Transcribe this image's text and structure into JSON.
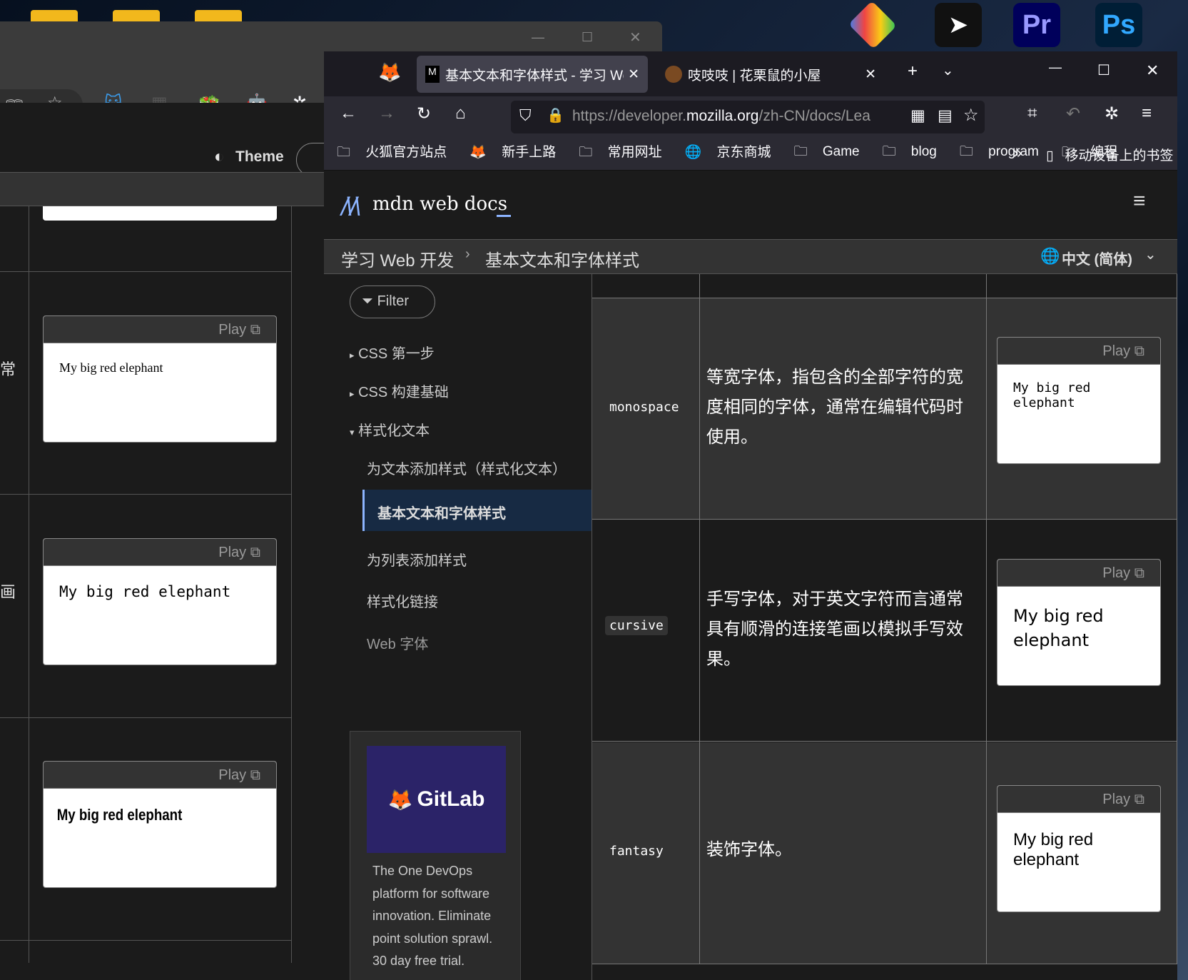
{
  "desktop": {
    "icons": [
      "folder-icon",
      "folder-icon",
      "folder-icon",
      "git-app-icon",
      "navigation-app-icon",
      "premiere-pro-icon",
      "photoshop-icon"
    ],
    "pr_label": "Pr",
    "ps_label": "Ps"
  },
  "back_window": {
    "theme_label": "Theme",
    "cards": [
      {
        "play": "Play",
        "text": "My big red elephant"
      },
      {
        "play": "Play",
        "text": "My big red elephant"
      },
      {
        "play": "Play",
        "text": "My big red elephant"
      }
    ],
    "side_chars": [
      "常",
      "画"
    ]
  },
  "browser": {
    "tabs": [
      {
        "title": "基本文本和字体样式 - 学习 Web",
        "active": true
      },
      {
        "title": "吱吱吱 | 花栗鼠的小屋",
        "active": false
      }
    ],
    "url": "https://developer.mozilla.org/zh-CN/docs/Learn",
    "url_prefix": "https://developer.",
    "url_domain": "mozilla.org",
    "url_rest": "/zh-CN/docs/Lea",
    "bookmarks": [
      "火狐官方站点",
      "新手上路",
      "常用网址",
      "京东商城",
      "Game",
      "blog",
      "program",
      "编程"
    ],
    "mobile_bookmarks": "移动设备上的书签"
  },
  "mdn": {
    "logo": "mdn web docs",
    "breadcrumb": [
      "学习 Web 开发",
      "基本文本和字体样式"
    ],
    "language": "中文 (简体)",
    "filter": "Filter",
    "sidebar": [
      {
        "label": "CSS 第一步",
        "marker": "▸"
      },
      {
        "label": "CSS 构建基础",
        "marker": "▸"
      },
      {
        "label": "样式化文本",
        "marker": "▾"
      }
    ],
    "sub_items": [
      "为文本添加样式（样式化文本）",
      "基本文本和字体样式",
      "为列表添加样式",
      "样式化链接",
      "Web 字体"
    ],
    "active_item": "基本文本和字体样式",
    "ad": {
      "brand": "GitLab",
      "text": "The One DevOps platform for software innovation. Eliminate point solution sprawl. 30 day free trial."
    },
    "rows": [
      {
        "name": "monospace",
        "desc": "等宽字体，指包含的全部字符的宽度相同的字体，通常在编辑代码时使用。",
        "play": "Play",
        "sample": "My big red elephant"
      },
      {
        "name": "cursive",
        "desc": "手写字体，对于英文字符而言通常具有顺滑的连接笔画以模拟手写效果。",
        "play": "Play",
        "sample": "My big red elephant"
      },
      {
        "name": "fantasy",
        "desc": "装饰字体。",
        "play": "Play",
        "sample": "My big red elephant"
      }
    ]
  },
  "colors": {
    "accent": "#8cb4ff",
    "active_bg": "#172a43",
    "gitlab_bg": "#2b2368",
    "gitlab_orange": "#fc6d26"
  }
}
